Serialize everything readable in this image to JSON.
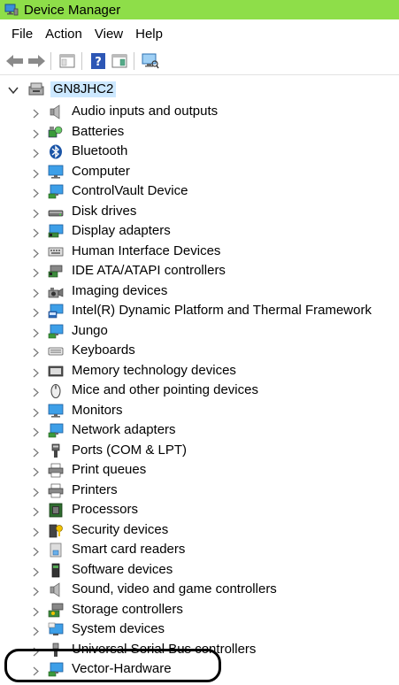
{
  "window": {
    "title": "Device Manager",
    "titlebar_color": "#8ede49"
  },
  "menu": {
    "items": [
      "File",
      "Action",
      "View",
      "Help"
    ]
  },
  "toolbar": {
    "buttons": [
      "back-icon",
      "forward-icon",
      "show-hide-console-tree-icon",
      "help-icon",
      "properties-icon",
      "scan-hardware-icon"
    ]
  },
  "tree": {
    "root": {
      "label": "GN8JHC2",
      "icon": "computer-icon",
      "expanded": true
    },
    "items": [
      {
        "label": "Audio inputs and outputs",
        "icon": "speaker-icon"
      },
      {
        "label": "Batteries",
        "icon": "battery-icon"
      },
      {
        "label": "Bluetooth",
        "icon": "bluetooth-icon"
      },
      {
        "label": "Computer",
        "icon": "monitor-icon"
      },
      {
        "label": "ControlVault Device",
        "icon": "network-monitor-icon"
      },
      {
        "label": "Disk drives",
        "icon": "disk-drive-icon"
      },
      {
        "label": "Display adapters",
        "icon": "display-adapter-icon"
      },
      {
        "label": "Human Interface Devices",
        "icon": "keyboard-hid-icon"
      },
      {
        "label": "IDE ATA/ATAPI controllers",
        "icon": "ide-controller-icon"
      },
      {
        "label": "Imaging devices",
        "icon": "camera-icon"
      },
      {
        "label": "Intel(R) Dynamic Platform and Thermal Framework",
        "icon": "intel-device-icon"
      },
      {
        "label": "Jungo",
        "icon": "network-monitor-icon"
      },
      {
        "label": "Keyboards",
        "icon": "keyboard-icon"
      },
      {
        "label": "Memory technology devices",
        "icon": "memory-icon"
      },
      {
        "label": "Mice and other pointing devices",
        "icon": "mouse-icon"
      },
      {
        "label": "Monitors",
        "icon": "monitor-icon"
      },
      {
        "label": "Network adapters",
        "icon": "network-monitor-icon"
      },
      {
        "label": "Ports (COM & LPT)",
        "icon": "port-icon"
      },
      {
        "label": "Print queues",
        "icon": "printer-icon"
      },
      {
        "label": "Printers",
        "icon": "printer-icon"
      },
      {
        "label": "Processors",
        "icon": "processor-icon"
      },
      {
        "label": "Security devices",
        "icon": "security-key-icon"
      },
      {
        "label": "Smart card readers",
        "icon": "smart-card-icon"
      },
      {
        "label": "Software devices",
        "icon": "software-device-icon"
      },
      {
        "label": "Sound, video and game controllers",
        "icon": "speaker-icon"
      },
      {
        "label": "Storage controllers",
        "icon": "storage-controller-icon"
      },
      {
        "label": "System devices",
        "icon": "system-device-icon"
      },
      {
        "label": "Universal Serial Bus controllers",
        "icon": "usb-icon"
      },
      {
        "label": "Vector-Hardware",
        "icon": "network-monitor-icon"
      }
    ]
  }
}
